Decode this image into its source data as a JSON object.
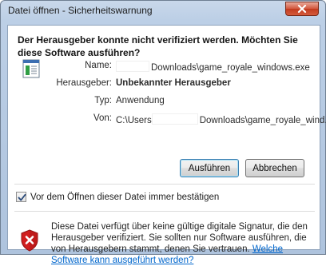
{
  "window": {
    "title": "Datei öffnen - Sicherheitswarnung"
  },
  "heading": "Der Herausgeber konnte nicht verifiziert werden. Möchten Sie diese Software ausführen?",
  "fields": {
    "name": {
      "label": "Name:",
      "value": "Downloads\\game_royale_windows.exe"
    },
    "publisher": {
      "label": "Herausgeber:",
      "value": "Unbekannter Herausgeber"
    },
    "type": {
      "label": "Typ:",
      "value": "Anwendung"
    },
    "from": {
      "label": "Von:",
      "value_prefix": "C:\\Users",
      "value": "Downloads\\game_royale_wind..."
    }
  },
  "buttons": {
    "run": "Ausführen",
    "cancel": "Abbrechen"
  },
  "checkbox": {
    "label": "Vor dem Öffnen dieser Datei immer bestätigen",
    "checked": true
  },
  "warning": {
    "text": "Diese Datei verfügt über keine gültige digitale Signatur, die den Herausgeber verifiziert. Sie sollten nur Software ausführen, die von Herausgebern stammt, denen Sie vertrauen.",
    "link": "Welche Software kann ausgeführt werden?"
  },
  "icons": {
    "close": "close-icon",
    "file": "application-icon",
    "shield": "shield-error-icon",
    "check": "checkmark-icon"
  },
  "colors": {
    "link": "#0066cc",
    "close_button": "#c94a2d",
    "shield": "#d11f1f"
  }
}
